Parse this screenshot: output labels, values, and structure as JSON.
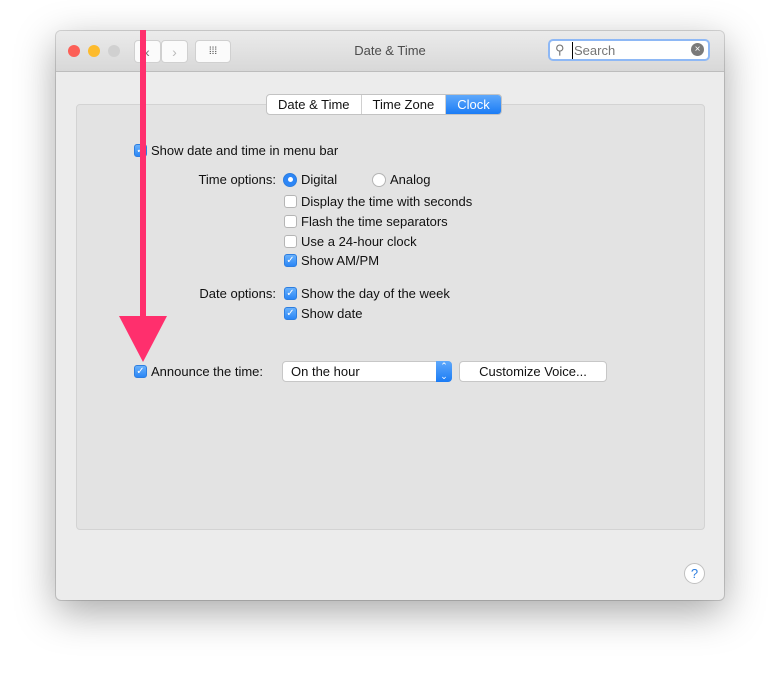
{
  "window": {
    "title": "Date & Time"
  },
  "search": {
    "placeholder": "Search"
  },
  "tabs": [
    {
      "label": "Date & Time"
    },
    {
      "label": "Time Zone"
    },
    {
      "label": "Clock",
      "selected": true
    }
  ],
  "clock": {
    "show_in_menu_bar": {
      "label": "Show date and time in menu bar",
      "checked": true
    },
    "time_options_label": "Time options:",
    "digital": {
      "label": "Digital",
      "selected": true
    },
    "analog": {
      "label": "Analog",
      "selected": false
    },
    "time_checks": [
      {
        "label": "Display the time with seconds",
        "checked": false
      },
      {
        "label": "Flash the time separators",
        "checked": false
      },
      {
        "label": "Use a 24-hour clock",
        "checked": false
      },
      {
        "label": "Show AM/PM",
        "checked": true
      }
    ],
    "date_options_label": "Date options:",
    "date_checks": [
      {
        "label": "Show the day of the week",
        "checked": true
      },
      {
        "label": "Show date",
        "checked": true
      }
    ],
    "announce": {
      "label": "Announce the time:",
      "checked": true,
      "interval": "On the hour",
      "customize_label": "Customize Voice..."
    }
  },
  "help_label": "?",
  "colors": {
    "accent": "#2b86f6",
    "annotation_arrow": "#ff2f6d"
  }
}
